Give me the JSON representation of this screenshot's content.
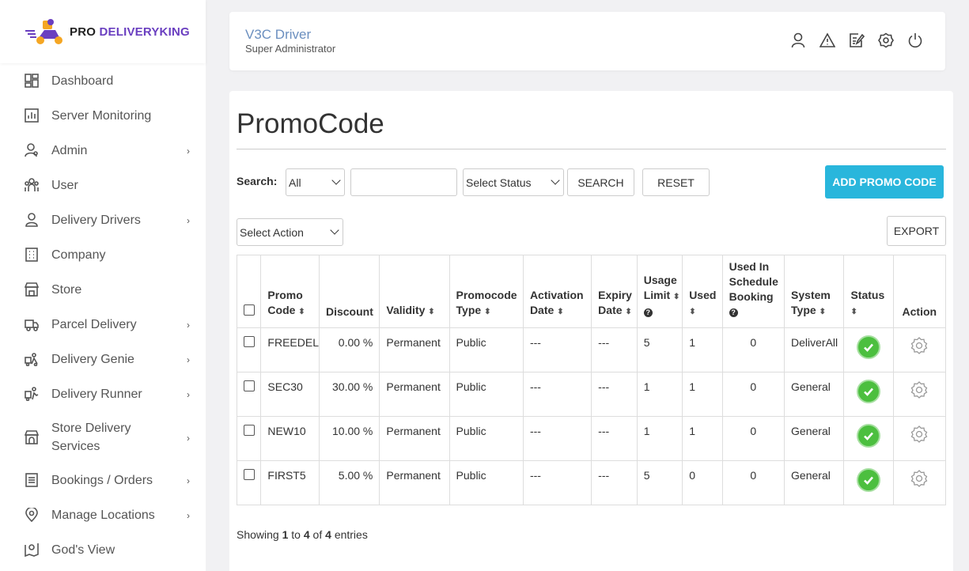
{
  "brand": {
    "pro": "PRO",
    "name": "DELIVERYKING",
    "accent": "#6a3fc0"
  },
  "sidebar": {
    "items": [
      {
        "label": "Dashboard",
        "icon": "dashboard-icon",
        "expandable": false
      },
      {
        "label": "Server Monitoring",
        "icon": "chart-icon",
        "expandable": false
      },
      {
        "label": "Admin",
        "icon": "admin-icon",
        "expandable": true
      },
      {
        "label": "User",
        "icon": "users-icon",
        "expandable": false
      },
      {
        "label": "Delivery Drivers",
        "icon": "driver-icon",
        "expandable": true
      },
      {
        "label": "Company",
        "icon": "building-icon",
        "expandable": false
      },
      {
        "label": "Store",
        "icon": "store-icon",
        "expandable": false
      },
      {
        "label": "Parcel Delivery",
        "icon": "truck-icon",
        "expandable": true
      },
      {
        "label": "Delivery Genie",
        "icon": "genie-icon",
        "expandable": true
      },
      {
        "label": "Delivery Runner",
        "icon": "runner-icon",
        "expandable": true
      },
      {
        "label": "Store Delivery Services",
        "icon": "store-services-icon",
        "expandable": true
      },
      {
        "label": "Bookings / Orders",
        "icon": "document-icon",
        "expandable": true
      },
      {
        "label": "Manage Locations",
        "icon": "location-pin-icon",
        "expandable": true
      },
      {
        "label": "God's View",
        "icon": "map-view-icon",
        "expandable": false
      }
    ]
  },
  "header": {
    "user_name": "V3C Driver",
    "user_role": "Super Administrator",
    "icons": [
      "profile-icon",
      "warning-icon",
      "edit-log-icon",
      "settings-icon",
      "power-icon"
    ]
  },
  "page": {
    "title": "PromoCode",
    "search_label": "Search:",
    "search_scope": "All",
    "status_select": "Select Status",
    "search_button": "SEARCH",
    "reset_button": "RESET",
    "add_button": "ADD PROMO CODE",
    "action_select": "Select Action",
    "export_button": "EXPORT"
  },
  "table": {
    "headers": {
      "promo_code": "Promo Code",
      "discount": "Discount",
      "validity": "Validity",
      "promocode_type": "Promocode Type",
      "activation_date": "Activation Date",
      "expiry_date": "Expiry Date",
      "usage_limit": "Usage Limit",
      "used": "Used",
      "used_in_schedule": "Used In Schedule Booking",
      "system_type": "System Type",
      "status": "Status",
      "action": "Action"
    },
    "rows": [
      {
        "code": "FREEDEL",
        "discount": "0.00 %",
        "validity": "Permanent",
        "type": "Public",
        "activation": "---",
        "expiry": "---",
        "limit": "5",
        "used": "1",
        "scheduled": "0",
        "system": "DeliverAll"
      },
      {
        "code": "SEC30",
        "discount": "30.00 %",
        "validity": "Permanent",
        "type": "Public",
        "activation": "---",
        "expiry": "---",
        "limit": "1",
        "used": "1",
        "scheduled": "0",
        "system": "General"
      },
      {
        "code": "NEW10",
        "discount": "10.00 %",
        "validity": "Permanent",
        "type": "Public",
        "activation": "---",
        "expiry": "---",
        "limit": "1",
        "used": "1",
        "scheduled": "0",
        "system": "General"
      },
      {
        "code": "FIRST5",
        "discount": "5.00 %",
        "validity": "Permanent",
        "type": "Public",
        "activation": "---",
        "expiry": "---",
        "limit": "5",
        "used": "0",
        "scheduled": "0",
        "system": "General"
      }
    ]
  },
  "footer": {
    "showing_prefix": "Showing",
    "from": "1",
    "to_word": "to",
    "to": "4",
    "of_word": "of",
    "total": "4",
    "suffix": "entries"
  },
  "colors": {
    "add_button": "#29b6dc",
    "status_active": "#4cbf3f",
    "user_name": "#6b8fbf"
  }
}
